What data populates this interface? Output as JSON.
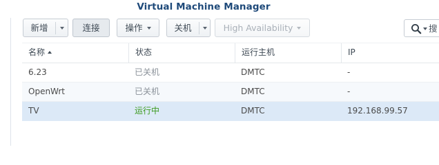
{
  "window": {
    "title": "Virtual Machine Manager"
  },
  "toolbar": {
    "new_label": "新增",
    "connect_label": "连接",
    "action_label": "操作",
    "shutdown_label": "关机",
    "ha_label": "High Availability"
  },
  "search": {
    "placeholder": "搜"
  },
  "table": {
    "columns": [
      {
        "label": "名称",
        "sort": "ascending"
      },
      {
        "label": "状态"
      },
      {
        "label": "运行主机"
      },
      {
        "label": "IP"
      }
    ],
    "rows": [
      {
        "name": "6.23",
        "status": "已关机",
        "status_kind": "off",
        "host": "DMTC",
        "ip": "-",
        "selected": false
      },
      {
        "name": "OpenWrt",
        "status": "已关机",
        "status_kind": "off",
        "host": "DMTC",
        "ip": "-",
        "selected": false
      },
      {
        "name": "TV",
        "status": "运行中",
        "status_kind": "running",
        "host": "DMTC",
        "ip": "192.168.99.57",
        "selected": true
      }
    ]
  },
  "colors": {
    "title": "#1f4a7a",
    "running": "#3c9a1f",
    "stopped": "#8a9199",
    "selected_row": "#dce9f7"
  },
  "icons": {
    "search": "magnifier-icon",
    "dropdown": "chevron-down-icon",
    "sort": "sort-ascending-icon"
  }
}
